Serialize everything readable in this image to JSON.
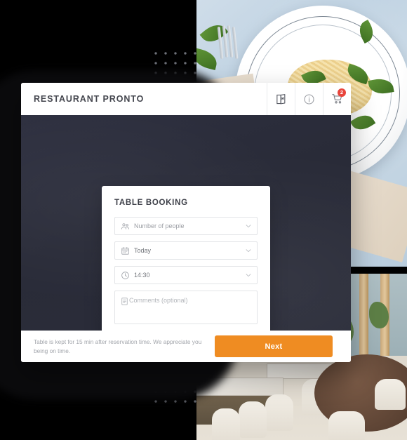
{
  "app": {
    "brand_title": "RESTAURANT PRONTO",
    "header_actions": [
      {
        "name": "menu-book-icon",
        "label": "Menu"
      },
      {
        "name": "info-icon",
        "label": "Info"
      },
      {
        "name": "cart-icon",
        "label": "Cart",
        "badge": "2"
      }
    ]
  },
  "booking": {
    "title": "TABLE BOOKING",
    "fields": [
      {
        "icon": "people-icon",
        "value": "Number of people",
        "filled": false,
        "chevron": "chevron-down-icon"
      },
      {
        "icon": "calendar-icon",
        "value": "Today",
        "filled": true,
        "chevron": "chevron-down-icon"
      },
      {
        "icon": "clock-icon",
        "value": "14:30",
        "filled": true,
        "chevron": "chevron-down-icon"
      }
    ],
    "comments": {
      "icon": "note-icon",
      "placeholder": "Comments (optional)"
    }
  },
  "footer": {
    "note": "Table is kept for 15 min after reservation time. We appreciate you being on time.",
    "next_label": "Next"
  },
  "theme": {
    "accent": "#ef8c22",
    "hero_dark": "#2b2d3a",
    "badge_red": "#e8453c",
    "text_dark": "#45474f",
    "text_muted": "#9a9da3",
    "page_background": "#000000"
  },
  "background": {
    "photos": [
      {
        "name": "food-photo",
        "description": "Pasta with pesto and spinach leaves on a white plate"
      },
      {
        "name": "restaurant-interior-photo",
        "description": "Restaurant interior with tables and cream chairs"
      }
    ],
    "decorations": [
      {
        "name": "dot-grid-top"
      },
      {
        "name": "dot-grid-bottom"
      }
    ]
  }
}
